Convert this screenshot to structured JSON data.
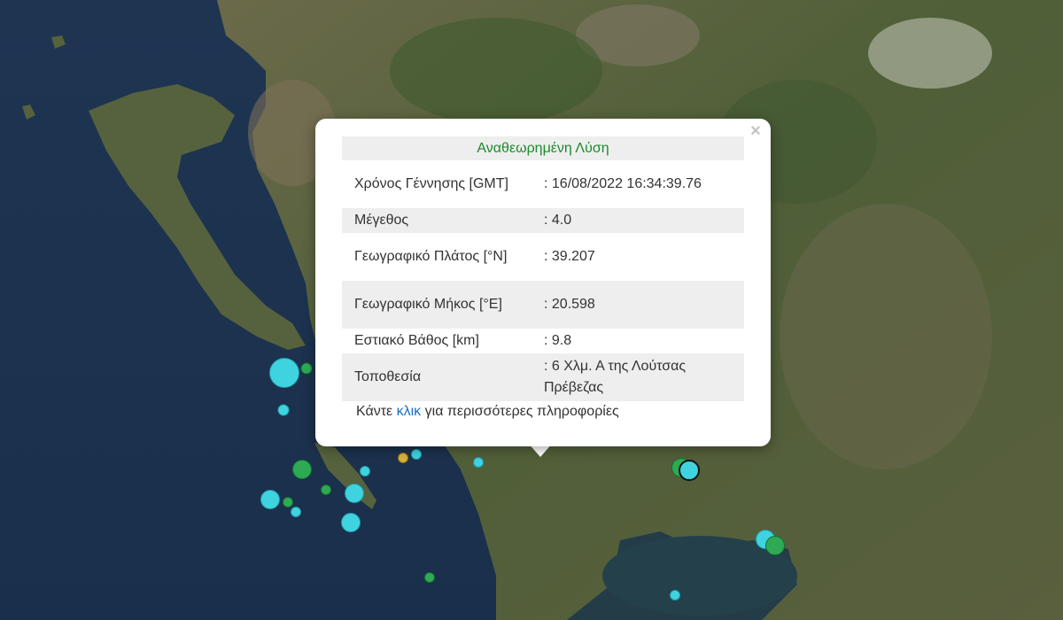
{
  "popup": {
    "header": "Αναθεωρημένη Λύση",
    "close_symbol": "×",
    "rows": [
      {
        "label": "Χρόνος Γέννησης [GMT]",
        "value": ": 16/08/2022 16:34:39.76"
      },
      {
        "label": "Μέγεθος",
        "value": ": 4.0"
      },
      {
        "label": "Γεωγραφικό Πλάτος [°N]",
        "value": ": 39.207"
      },
      {
        "label": "Γεωγραφικό Μήκος [°E]",
        "value": ": 20.598"
      },
      {
        "label": "Εστιακό Βάθος [km]",
        "value": ": 9.8"
      },
      {
        "label": "Τοποθεσία",
        "value": ": 6 Χλμ. Α της Λούτσας Πρέβεζας"
      }
    ],
    "more_prefix": "Κάντε ",
    "more_link": "κλικ",
    "more_suffix": " για περισσότερες πληροφορίες"
  },
  "colors": {
    "sea": "#1a2f4b",
    "land": "#4e5e3a",
    "recent_quake": "#3fd3e0",
    "older_quake": "#2eaa55",
    "mid_quake": "#d7b23a",
    "header_text": "#1d8a2b",
    "link": "#1a6fc4"
  }
}
